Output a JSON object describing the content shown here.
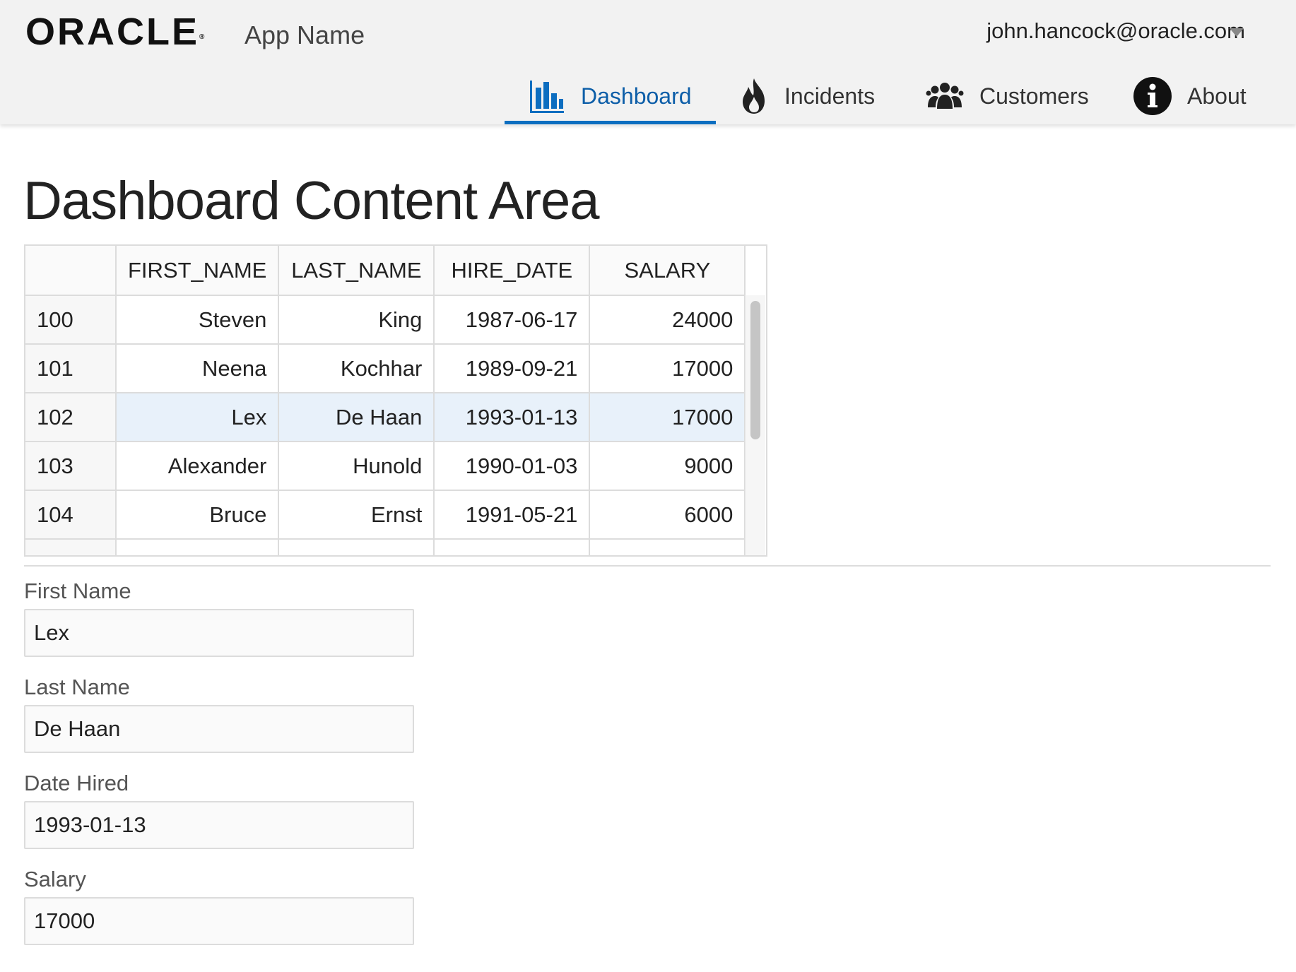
{
  "header": {
    "logo_text": "ORACLE",
    "app_name": "App Name",
    "user_email": "john.hancock@oracle.com"
  },
  "nav": [
    {
      "label": "Dashboard",
      "icon": "bar-chart-icon",
      "active": true
    },
    {
      "label": "Incidents",
      "icon": "fire-icon",
      "active": false
    },
    {
      "label": "Customers",
      "icon": "people-icon",
      "active": false
    },
    {
      "label": "About",
      "icon": "info-icon",
      "active": false
    }
  ],
  "page_title": "Dashboard Content Area",
  "table": {
    "columns": [
      "FIRST_NAME",
      "LAST_NAME",
      "HIRE_DATE",
      "SALARY"
    ],
    "rows": [
      {
        "id": "100",
        "first_name": "Steven",
        "last_name": "King",
        "hire_date": "1987-06-17",
        "salary": "24000"
      },
      {
        "id": "101",
        "first_name": "Neena",
        "last_name": "Kochhar",
        "hire_date": "1989-09-21",
        "salary": "17000"
      },
      {
        "id": "102",
        "first_name": "Lex",
        "last_name": "De Haan",
        "hire_date": "1993-01-13",
        "salary": "17000"
      },
      {
        "id": "103",
        "first_name": "Alexander",
        "last_name": "Hunold",
        "hire_date": "1990-01-03",
        "salary": "9000"
      },
      {
        "id": "104",
        "first_name": "Bruce",
        "last_name": "Ernst",
        "hire_date": "1991-05-21",
        "salary": "6000"
      }
    ],
    "selected_row_id": "102"
  },
  "form": {
    "first_name_label": "First Name",
    "first_name_value": "Lex",
    "last_name_label": "Last Name",
    "last_name_value": "De Haan",
    "date_hired_label": "Date Hired",
    "date_hired_value": "1993-01-13",
    "salary_label": "Salary",
    "salary_value": "17000"
  },
  "colors": {
    "accent": "#0d6ec0",
    "selected_row": "#e8f1fa",
    "header_bg": "#f2f2f2"
  }
}
